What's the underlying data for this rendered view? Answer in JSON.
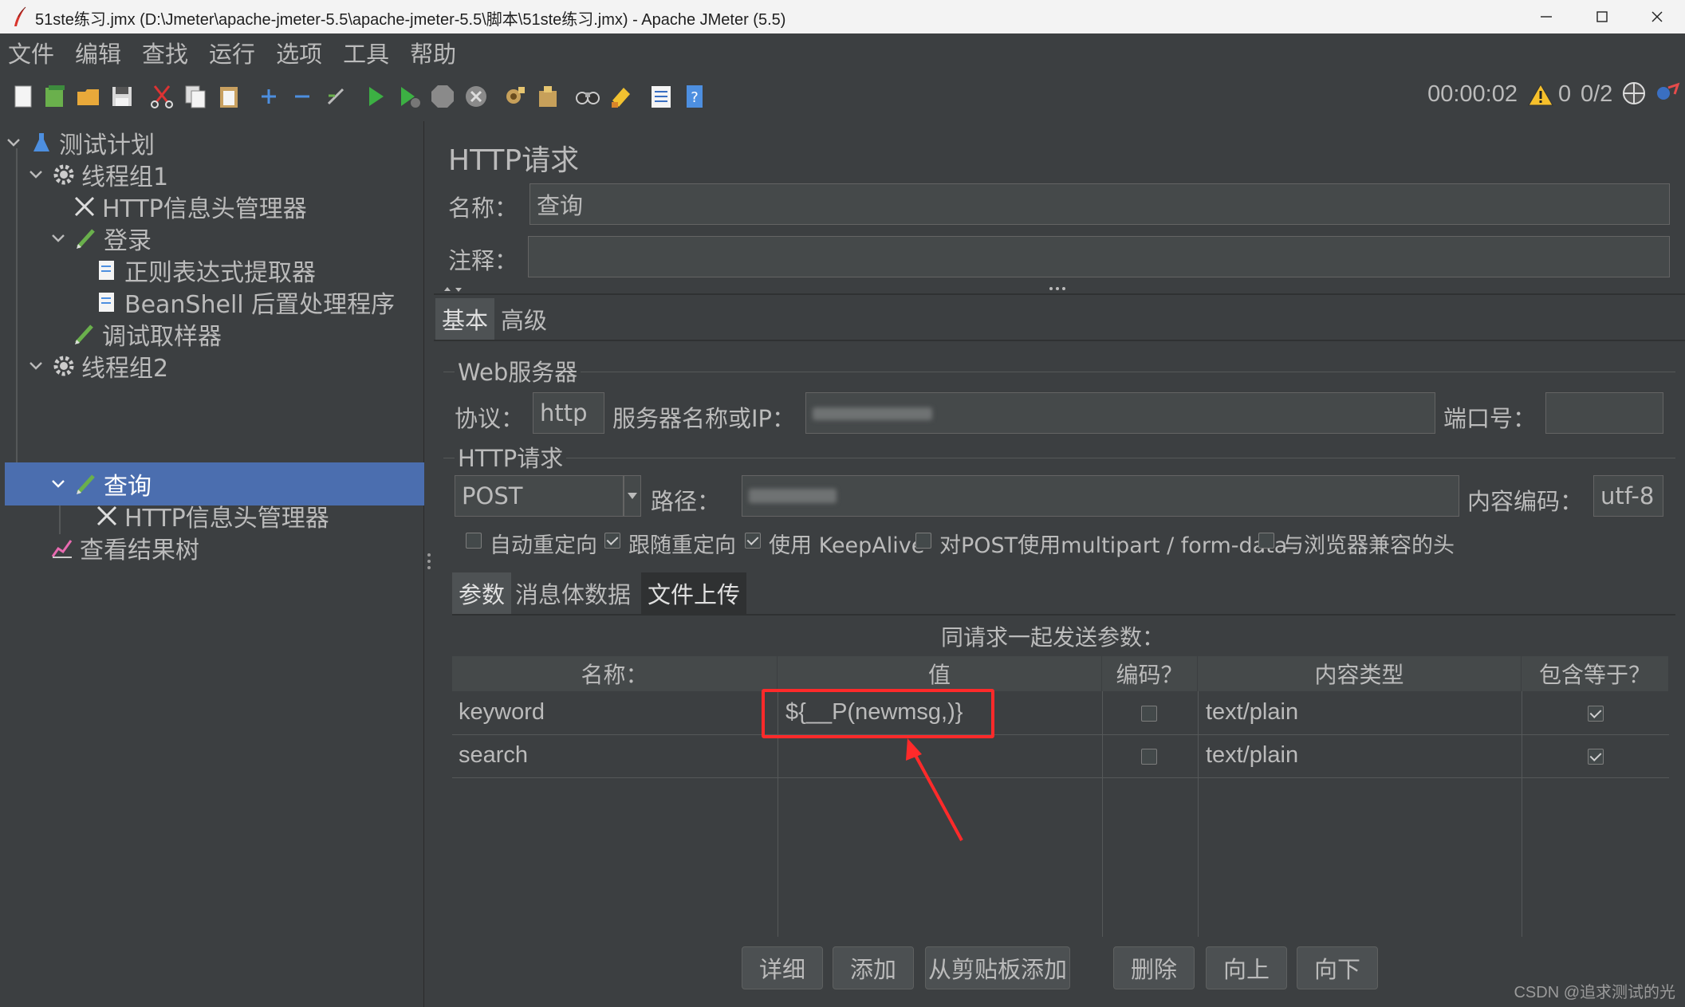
{
  "window": {
    "title": "51ste练习.jmx (D:\\Jmeter\\apache-jmeter-5.5\\apache-jmeter-5.5\\脚本\\51ste练习.jmx) - Apache JMeter (5.5)"
  },
  "menu": [
    "文件",
    "编辑",
    "查找",
    "运行",
    "选项",
    "工具",
    "帮助"
  ],
  "toolbar": {
    "icons": [
      "new-icon",
      "templates-icon",
      "open-icon",
      "save-icon",
      "cut-icon",
      "copy-icon",
      "paste-icon",
      "expand-icon",
      "collapse-icon",
      "toggle-icon",
      "start-icon",
      "start-no-pause-icon",
      "stop-icon",
      "shutdown-icon",
      "clear-icon",
      "clear-all-icon",
      "search-icon",
      "reset-search-icon",
      "function-helper-icon",
      "help-icon"
    ],
    "timer": "00:00:02",
    "error_count": "0",
    "threads": "0/2"
  },
  "tree": {
    "items": [
      {
        "label": "测试计划",
        "icon": "flask-icon"
      },
      {
        "label": "线程组1",
        "icon": "gear-icon"
      },
      {
        "label": "HTTP信息头管理器",
        "icon": "wrench-icon"
      },
      {
        "label": "登录",
        "icon": "pencil-icon"
      },
      {
        "label": "正则表达式提取器",
        "icon": "document-icon"
      },
      {
        "label": "BeanShell 后置处理程序",
        "icon": "document-icon"
      },
      {
        "label": "调试取样器",
        "icon": "pencil-icon"
      },
      {
        "label": "线程组2",
        "icon": "gear-icon"
      },
      {
        "label": "查询",
        "icon": "pencil-icon"
      },
      {
        "label": "HTTP信息头管理器",
        "icon": "wrench-icon"
      },
      {
        "label": "查看结果树",
        "icon": "chart-icon"
      }
    ],
    "selected": "查询"
  },
  "panel": {
    "title": "HTTP请求",
    "name_label": "名称：",
    "name_value": "查询",
    "comment_label": "注释：",
    "comment_value": "",
    "tabs": [
      "基本",
      "高级"
    ],
    "web_server": {
      "section": "Web服务器",
      "protocol_label": "协议：",
      "protocol_value": "http",
      "server_label": "服务器名称或IP：",
      "port_label": "端口号："
    },
    "http_request": {
      "section": "HTTP请求",
      "method": "POST",
      "path_label": "路径：",
      "encoding_label": "内容编码：",
      "encoding_value": "utf-8"
    },
    "options": [
      {
        "label": "自动重定向",
        "checked": false
      },
      {
        "label": "跟随重定向",
        "checked": true
      },
      {
        "label": "使用 KeepAlive",
        "checked": true
      },
      {
        "label": "对POST使用multipart / form-data",
        "checked": false
      },
      {
        "label": "与浏览器兼容的头",
        "checked": false
      }
    ],
    "subtabs": [
      "参数",
      "消息体数据",
      "文件上传"
    ],
    "params_caption": "同请求一起发送参数：",
    "columns": [
      "名称：",
      "值",
      "编码？",
      "内容类型",
      "包含等于？"
    ],
    "rows": [
      {
        "name": "keyword",
        "value": "${__P(newmsg,)}",
        "encode": false,
        "content_type": "text/plain",
        "include_equals": true
      },
      {
        "name": "search",
        "value": "",
        "encode": false,
        "content_type": "text/plain",
        "include_equals": true
      }
    ],
    "buttons": [
      "详细",
      "添加",
      "从剪贴板添加",
      "删除",
      "向上",
      "向下"
    ]
  },
  "annotation_color": "#ff2a2a",
  "watermark": "CSDN @追求测试的光"
}
